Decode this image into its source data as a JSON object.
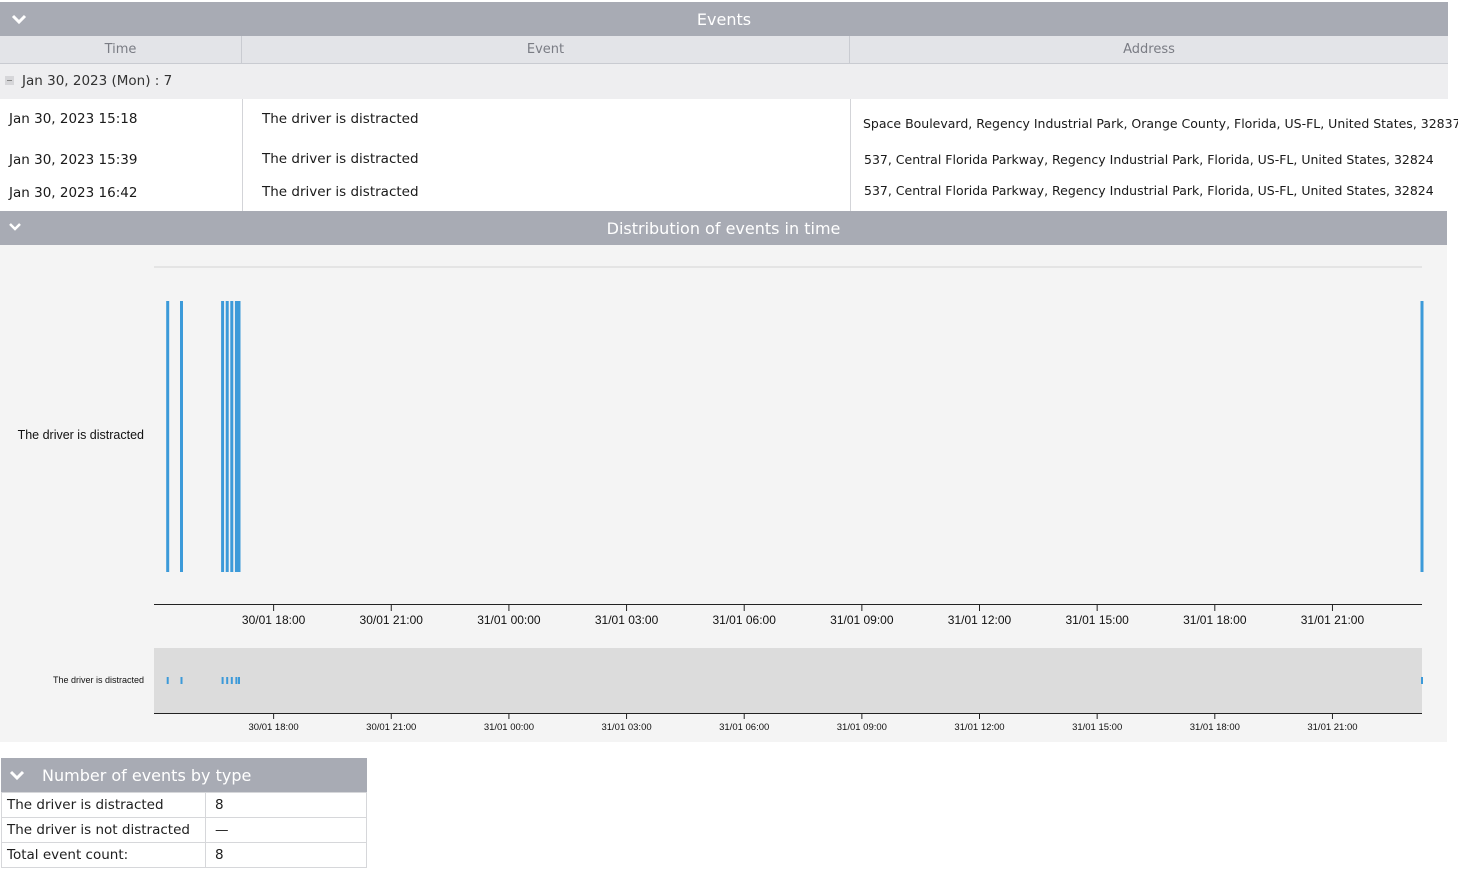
{
  "events_panel": {
    "title": "Events",
    "columns": [
      "Time",
      "Event",
      "Address"
    ],
    "group_label": "Jan 30, 2023 (Mon) : 7",
    "rows": [
      {
        "time": "Jan 30, 2023 15:18",
        "event": "The driver is distracted",
        "address": "Space Boulevard, Regency Industrial Park, Orange County, Florida, US-FL, United States, 32837"
      },
      {
        "time": "Jan 30, 2023 15:39",
        "event": "The driver is distracted",
        "address": "537, Central Florida Parkway, Regency Industrial Park, Florida, US-FL, United States, 32824"
      },
      {
        "time": "Jan 30, 2023 16:42",
        "event": "The driver is distracted",
        "address": "537, Central Florida Parkway, Regency Industrial Park, Florida, US-FL, United States, 32824"
      }
    ]
  },
  "distribution_panel": {
    "title": "Distribution of events in time"
  },
  "chart_data": {
    "type": "scatter",
    "row_label": "The driver is distracted",
    "x_range": [
      "30/01 14:57",
      "31/01 23:17"
    ],
    "x_ticks": [
      "30/01 18:00",
      "30/01 21:00",
      "31/01 00:00",
      "31/01 03:00",
      "31/01 06:00",
      "31/01 09:00",
      "31/01 12:00",
      "31/01 15:00",
      "31/01 18:00",
      "31/01 21:00"
    ],
    "events": [
      "30/01 15:18",
      "30/01 15:39",
      "30/01 16:42",
      "30/01 16:49",
      "30/01 16:56",
      "30/01 17:03",
      "30/01 17:07",
      "31/01 23:17"
    ],
    "color": "#3c9ad9"
  },
  "count_panel": {
    "title": "Number of events by type",
    "rows": [
      {
        "label": "The driver is distracted",
        "value": "8"
      },
      {
        "label": "The driver is not distracted",
        "value": "—"
      },
      {
        "label": "Total event count:",
        "value": "8"
      }
    ]
  }
}
